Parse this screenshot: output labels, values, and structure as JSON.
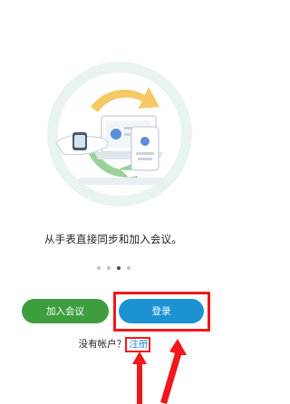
{
  "onboarding": {
    "caption": "从手表直接同步和加入会议。",
    "pager": {
      "count": 4,
      "active_index": 2
    }
  },
  "actions": {
    "join_label": "加入会议",
    "login_label": "登录"
  },
  "signup": {
    "prompt": "没有帐户？",
    "link_label": "注册"
  },
  "colors": {
    "join_button": "#3e9e3e",
    "login_button": "#1c92d2",
    "annotation": "#f0181c"
  },
  "icons": {
    "watch": "smartwatch-icon",
    "laptop": "laptop-icon",
    "phone": "phone-icon",
    "sync": "sync-arrows-icon"
  }
}
